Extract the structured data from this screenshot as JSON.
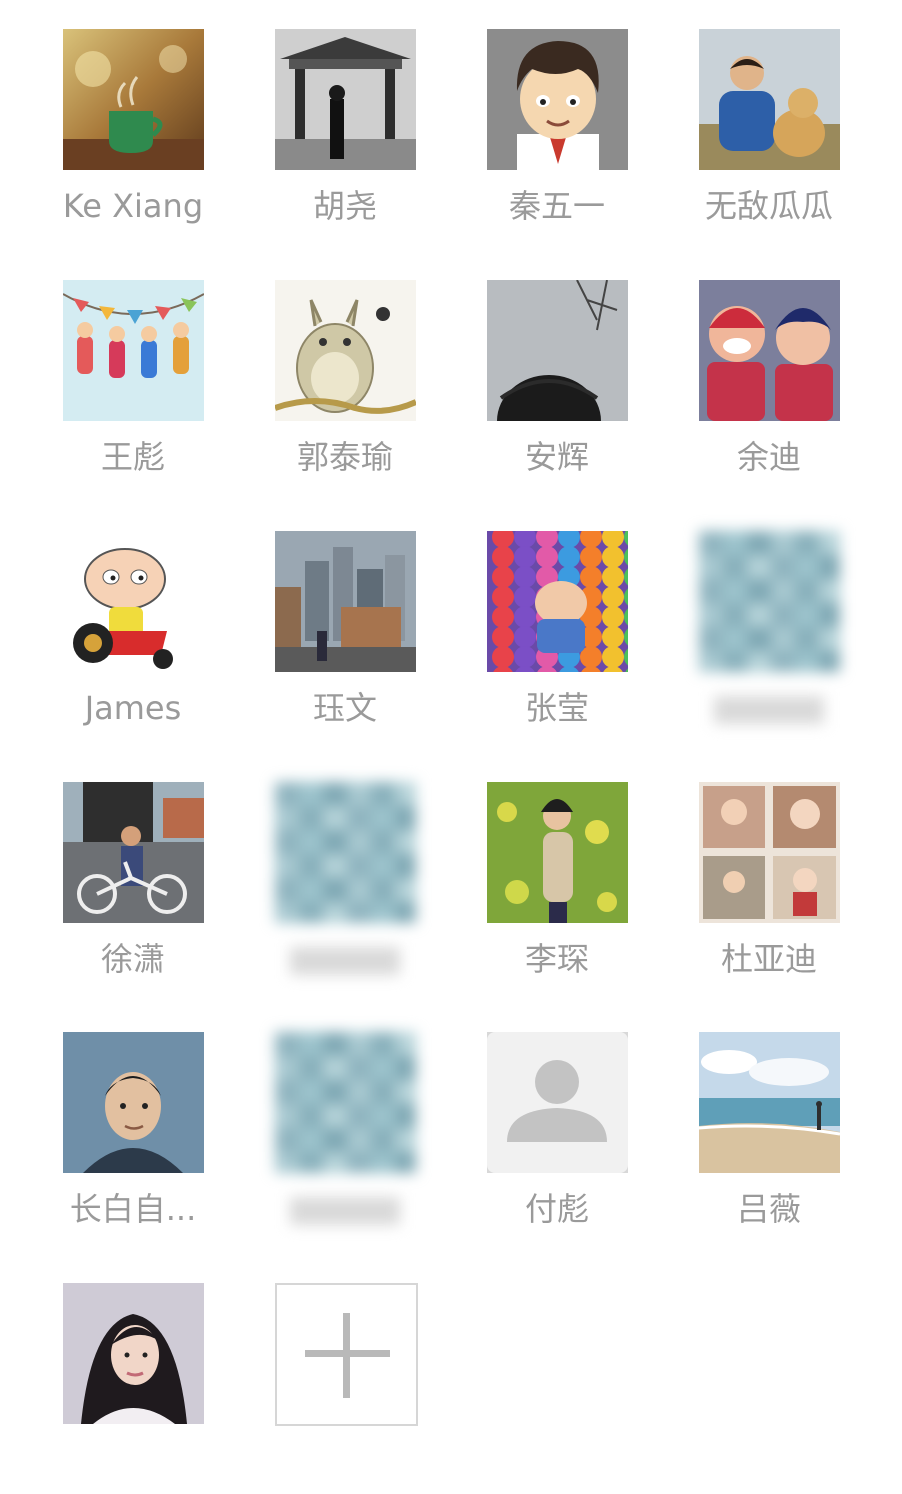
{
  "colors": {
    "background": "#ffffff",
    "name_text": "#9a9a9a",
    "add_border": "#d6d6d6",
    "add_plus": "#b9b9b9"
  },
  "members": [
    {
      "name": "Ke Xiang",
      "avatar": "coffee-cup-photo",
      "blurred": false
    },
    {
      "name": "胡尧",
      "avatar": "temple-bw-photo",
      "blurred": false
    },
    {
      "name": "秦五一",
      "avatar": "cartoon-boy",
      "blurred": false
    },
    {
      "name": "无敌瓜瓜",
      "avatar": "man-with-dog-photo",
      "blurred": false
    },
    {
      "name": "王彪",
      "avatar": "bunting-cartoon",
      "blurred": false
    },
    {
      "name": "郭泰瑜",
      "avatar": "totoro-sketch",
      "blurred": false
    },
    {
      "name": "安辉",
      "avatar": "head-sky-photo",
      "blurred": false
    },
    {
      "name": "余迪",
      "avatar": "toy-figures-photo",
      "blurred": false
    },
    {
      "name": "James",
      "avatar": "stewie-cartoon",
      "blurred": false
    },
    {
      "name": "珏文",
      "avatar": "city-street-photo",
      "blurred": false
    },
    {
      "name": "张莹",
      "avatar": "ball-pit-photo",
      "blurred": false
    },
    {
      "name": "",
      "avatar": "pixelated-avatar",
      "blurred": true
    },
    {
      "name": "徐潇",
      "avatar": "man-with-bike-photo",
      "blurred": false
    },
    {
      "name": "",
      "avatar": "pixelated-avatar",
      "blurred": true
    },
    {
      "name": "李琛",
      "avatar": "woman-flowers-photo",
      "blurred": false
    },
    {
      "name": "杜亚迪",
      "avatar": "baby-collage-photo",
      "blurred": false
    },
    {
      "name": "长白自...",
      "avatar": "man-portrait-photo",
      "blurred": false
    },
    {
      "name": "",
      "avatar": "pixelated-avatar",
      "blurred": true
    },
    {
      "name": "付彪",
      "avatar": "default-person-icon",
      "blurred": false
    },
    {
      "name": "吕薇",
      "avatar": "beach-photo",
      "blurred": false
    },
    {
      "name": "",
      "avatar": "woman-selfie-photo",
      "blurred": false
    }
  ],
  "add_button": {
    "icon": "plus-icon"
  }
}
